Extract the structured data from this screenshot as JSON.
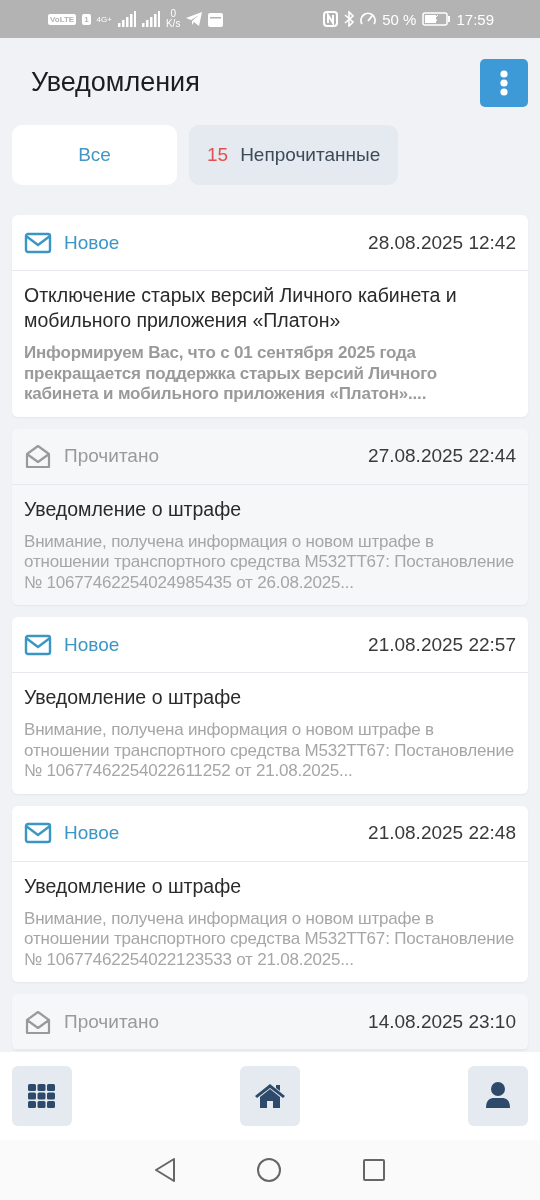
{
  "status_bar": {
    "network": "VoLTE",
    "sim": "1",
    "generation": "4G+",
    "speed_value": "0",
    "speed_unit": "K/s",
    "battery": "50 %",
    "time": "17:59"
  },
  "header": {
    "title": "Уведомления"
  },
  "tabs": [
    {
      "label": "Все",
      "selected": true
    },
    {
      "count": "15",
      "label": "Непрочитанные",
      "selected": false
    }
  ],
  "notifications": [
    {
      "read": false,
      "status": "Новое",
      "date": "28.08.2025 12:42",
      "title": "Отключение старых версий Личного кабинета и мобильного приложения «Платон»",
      "preview": "Информируем Вас, что с 01 сентября 2025 года прекращается поддержка старых версий Личного кабинета и мобильного приложения «Платон»....",
      "preview_bold": true
    },
    {
      "read": true,
      "status": "Прочитано",
      "date": "27.08.2025 22:44",
      "title": "Уведомление о штрафе",
      "preview": "Внимание, получена информация о новом штрафе в отношении транспортного средства М532ТТ67: Постановление № 10677462254024985435 от 26.08.2025...",
      "preview_bold": false
    },
    {
      "read": false,
      "status": "Новое",
      "date": "21.08.2025 22:57",
      "title": "Уведомление о штрафе",
      "preview": "Внимание, получена информация о новом штрафе в отношении транспортного средства М532ТТ67: Постановление № 10677462254022611252 от 21.08.2025...",
      "preview_bold": false
    },
    {
      "read": false,
      "status": "Новое",
      "date": "21.08.2025 22:48",
      "title": "Уведомление о штрафе",
      "preview": "Внимание, получена информация о новом штрафе в отношении транспортного средства М532ТТ67: Постановление № 10677462254022123533 от 21.08.2025...",
      "preview_bold": false
    },
    {
      "read": true,
      "status": "Прочитано",
      "date": "14.08.2025 23:10"
    }
  ]
}
